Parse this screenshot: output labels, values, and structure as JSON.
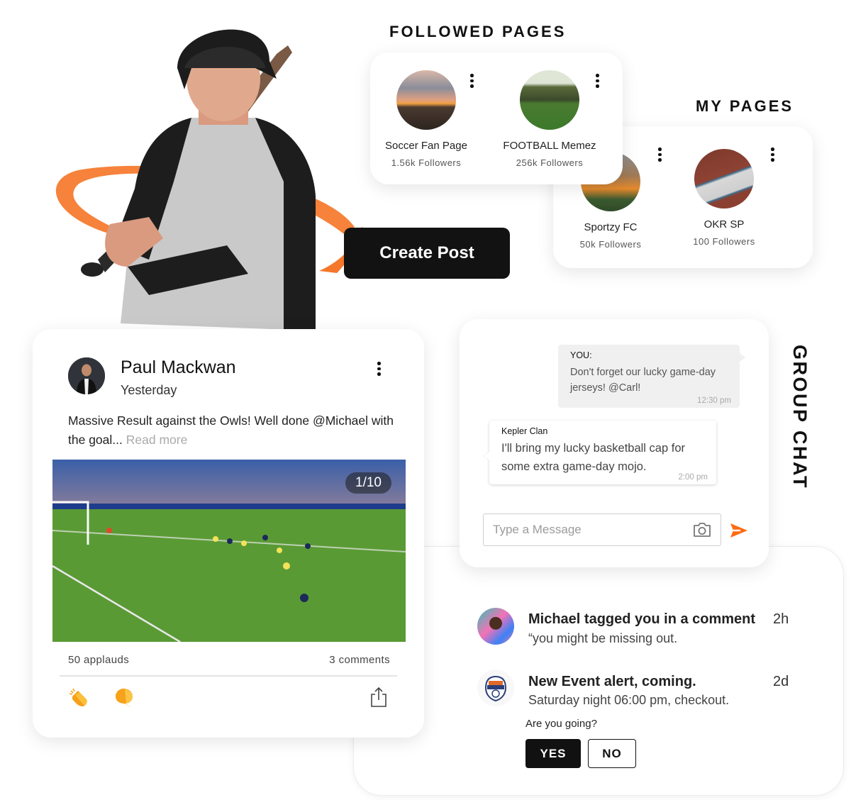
{
  "followed_pages": {
    "title": "FOLLOWED PAGES",
    "items": [
      {
        "name": "Soccer Fan Page",
        "followers": "1.56k Followers"
      },
      {
        "name": "FOOTBALL Memez",
        "followers": "256k Followers"
      }
    ]
  },
  "my_pages": {
    "title": "MY PAGES",
    "items": [
      {
        "name": "Sportzy FC",
        "followers": "50k Followers"
      },
      {
        "name": "OKR SP",
        "followers": "100 Followers"
      }
    ]
  },
  "create_post": {
    "label": "Create Post"
  },
  "post": {
    "author": "Paul Mackwan",
    "time": "Yesterday",
    "body": "Massive Result against the Owls! Well done @Michael with the goal...",
    "read_more": "Read more",
    "image_counter": "1/10",
    "applauds": "50 applauds",
    "comments": "3 comments",
    "actions": {
      "applaud_icon": "clapping-hands-icon",
      "comment_icon": "speech-bubble-icon",
      "share_icon": "share-icon"
    }
  },
  "chat": {
    "label": "GROUP CHAT",
    "messages": [
      {
        "sender": "YOU:",
        "text": "Don't forget our lucky game-day jerseys! @Carl!",
        "time": "12:30 pm"
      },
      {
        "sender": "Kepler Clan",
        "text": "I'll bring my lucky basketball cap for some extra game-day mojo.",
        "time": "2:00 pm"
      }
    ],
    "input_placeholder": "Type a Message",
    "accent": "#ff6a13"
  },
  "notifications": {
    "items": [
      {
        "title": "Michael tagged you in a comment",
        "subtitle": "“you might be missing out.",
        "time": "2h"
      },
      {
        "title": "New Event alert, coming.",
        "subtitle": "Saturday night 06:00 pm, checkout.",
        "time": "2d"
      }
    ],
    "rsvp": {
      "question": "Are you going?",
      "yes": "YES",
      "no": "NO"
    }
  },
  "colors": {
    "accent_orange": "#f5772a",
    "button_dark": "#121212"
  }
}
